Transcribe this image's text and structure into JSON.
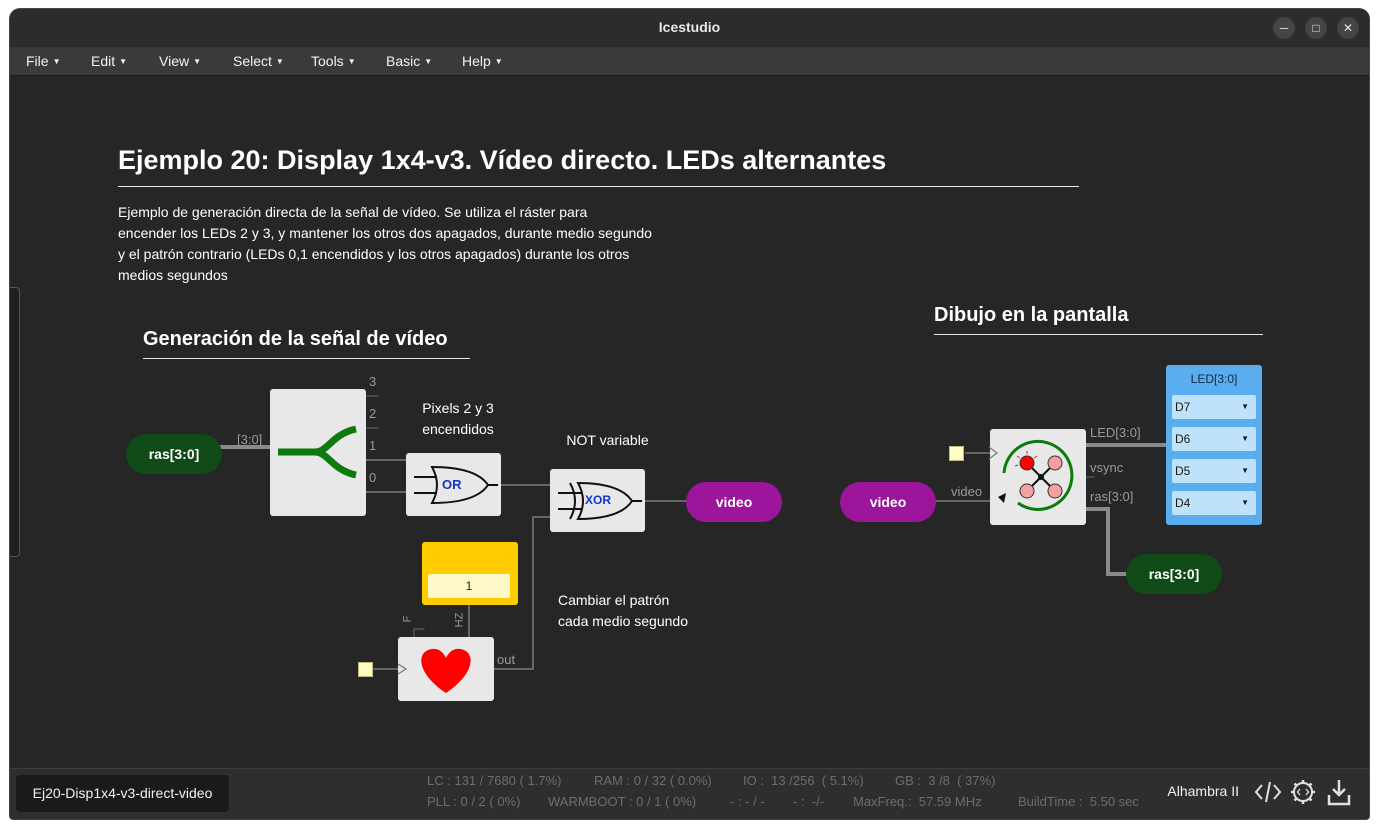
{
  "window": {
    "title": "Icestudio",
    "controls": {
      "minimize": "─",
      "maximize": "□",
      "close": "✕"
    }
  },
  "menu": {
    "items": [
      {
        "label": "File"
      },
      {
        "label": "Edit"
      },
      {
        "label": "View"
      },
      {
        "label": "Select"
      },
      {
        "label": "Tools"
      },
      {
        "label": "Basic"
      },
      {
        "label": "Help"
      }
    ],
    "caret": "▼"
  },
  "canvas": {
    "title": "Ejemplo 20: Display 1x4-v3. Vídeo directo. LEDs alternantes",
    "description_lines": [
      "Ejemplo de generación directa de la señal de vídeo. Se utiliza el ráster para",
      "encender los LEDs 2 y 3, y mantener los otros dos apagados, durante medio segundo",
      "y el patrón contrario (LEDs 0,1 encendidos y los otros apagados) durante los otros",
      "medios segundos"
    ],
    "section_left": "Generación de la señal de vídeo",
    "section_right": "Dibujo en la pantalla",
    "notes": {
      "pixels": [
        "Pixels 2 y 3",
        "encendidos"
      ],
      "not_var": "NOT variable",
      "cambiar": [
        "Cambiar el patrón",
        "cada medio segundo"
      ]
    },
    "blocks": {
      "ras_in": "ras[3:0]",
      "split_bus": "[3:0]",
      "split_outputs": [
        "3",
        "2",
        "1",
        "0"
      ],
      "or_label": "OR",
      "xor_label": "XOR",
      "video_out": "video",
      "video_in": "video",
      "const_value": "1",
      "heart_in_label": "F",
      "heart_hz_label": "HZ",
      "heart_out_label": "out",
      "display_in_label": "video",
      "display_outputs": [
        "LED[3:0]",
        "vsync",
        "ras[3:0]"
      ],
      "ras_out": "ras[3:0]",
      "led_title": "LED[3:0]",
      "led_pins": [
        "D7",
        "D6",
        "D5",
        "D4"
      ],
      "led_caret": "▼"
    }
  },
  "status": {
    "tab_label": "Ej20-Disp1x4-v3-direct-video",
    "lc": "LC : 131 / 7680 ( 1.7%)",
    "ram": "RAM : 0 / 32 ( 0.0%)",
    "io": "IO :  13 /256  ( 5.1%)",
    "gb": "GB :  3 /8  ( 37%)",
    "pll": "PLL : 0 / 2 ( 0%)",
    "warmboot": "WARMBOOT : 0 / 1 ( 0%)",
    "dash1": "- : - / -",
    "dash2": "- :  -/-",
    "maxfreq": "MaxFreq.:  57.59 MHz",
    "buildtime": "BuildTime :  5.50 sec",
    "board": "Alhambra II"
  },
  "colors": {
    "background": "#262626",
    "wire": "#7a7a7a",
    "bus": "#8a8a8a",
    "ras_pill": "#0f4a17",
    "video_pill": "#9c159b",
    "const_block": "#ffcc00",
    "led_block": "#5aaef0",
    "split_symbol": "#0d7a0d",
    "heart": "#ff0000"
  }
}
